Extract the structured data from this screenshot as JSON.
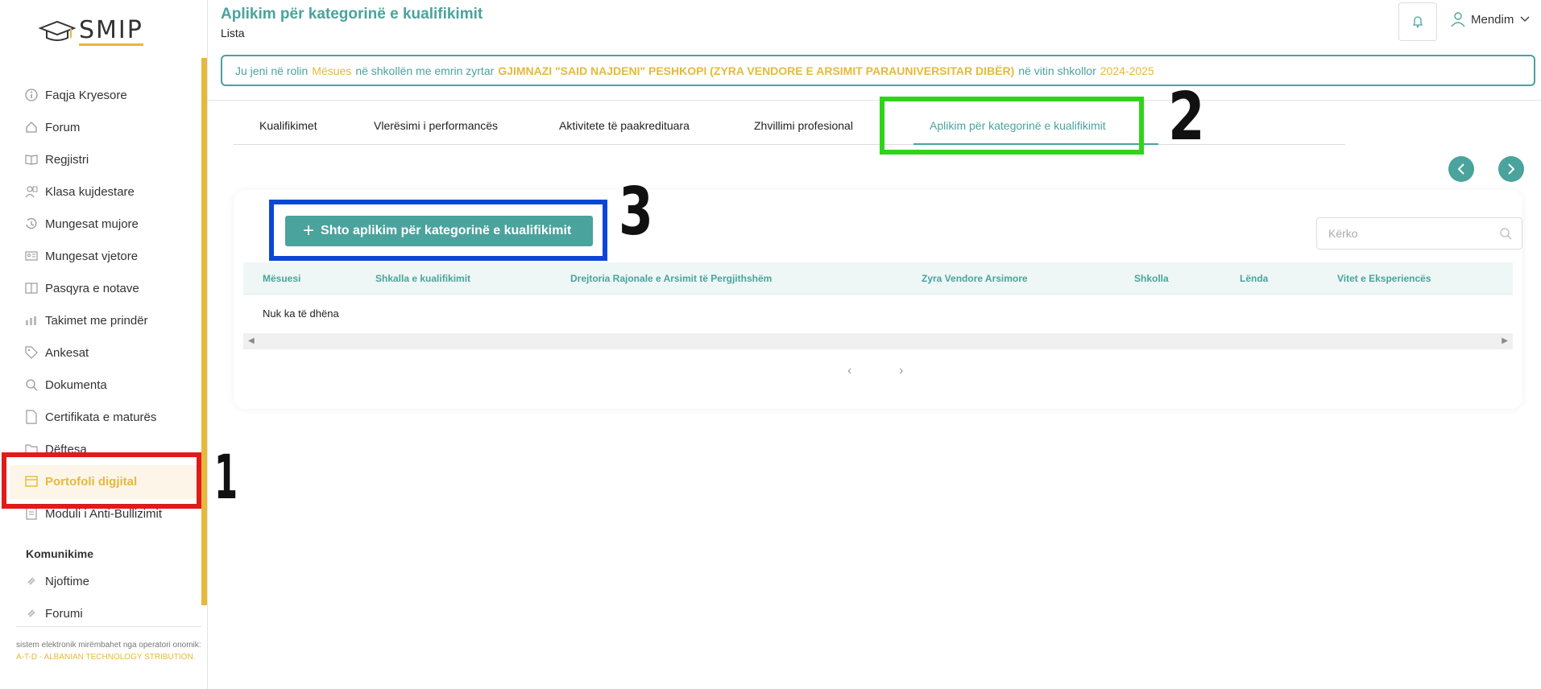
{
  "sidebar": {
    "logo": "SMIP",
    "items": [
      {
        "label": "Faqja Kryesore",
        "icon": "info-icon"
      },
      {
        "label": "Forum",
        "icon": "home-icon"
      },
      {
        "label": "Regjistri",
        "icon": "book-icon"
      },
      {
        "label": "Klasa kujdestare",
        "icon": "class-icon"
      },
      {
        "label": "Mungesat mujore",
        "icon": "history-icon"
      },
      {
        "label": "Mungesat vjetore",
        "icon": "id-card-icon"
      },
      {
        "label": "Pasqyra e notave",
        "icon": "book-open-icon"
      },
      {
        "label": "Takimet me prindër",
        "icon": "chart-icon"
      },
      {
        "label": "Ankesat",
        "icon": "tag-icon"
      },
      {
        "label": "Dokumenta",
        "icon": "search-icon"
      },
      {
        "label": "Certifikata e maturës",
        "icon": "file-icon"
      },
      {
        "label": "Dëftesa",
        "icon": "folder-icon"
      },
      {
        "label": "Portofoli digjital",
        "icon": "calendar-icon",
        "active": true
      },
      {
        "label": "Moduli i Anti-Bullizimit",
        "icon": "document-icon"
      }
    ],
    "section_title": "Komunikime",
    "comm_items": [
      {
        "label": "Njoftime",
        "icon": "link-icon"
      },
      {
        "label": "Forumi",
        "icon": "link-icon"
      }
    ],
    "footer_prefix": "sistem elektronik mirëmbahet nga operatori onomik:",
    "footer_highlight": "A-T-D - ALBANIAN TECHNOLOGY STRIBUTION."
  },
  "header": {
    "title": "Aplikim për kategorinë e kualifikimit",
    "subtitle": "Lista",
    "user_name": "Mendim"
  },
  "role_bar": {
    "p1": "Ju jeni në rolin",
    "role": "Mësues",
    "p2": "në shkollën me emrin zyrtar",
    "school": "GJIMNAZI \"SAID NAJDENI\" PESHKOPI (ZYRA VENDORE E ARSIMIT PARAUNIVERSITAR DIBËR)",
    "p3": "në vitin shkollor",
    "year": "2024-2025"
  },
  "tabs": [
    "Kualifikimet",
    "Vlerësimi i performancës",
    "Aktivitete të paakredituara",
    "Zhvillimi profesional",
    "Aplikim për kategorinë e kualifikimit"
  ],
  "annotations": [
    "1",
    "2",
    "3"
  ],
  "card": {
    "add_button": "Shto aplikim për kategorinë e kualifikimit",
    "search_placeholder": "Kërko",
    "columns": [
      "Mësuesi",
      "Shkalla e kualifikimit",
      "Drejtoria Rajonale e Arsimit të Pergjithshëm",
      "Zyra Vendore Arsimore",
      "Shkolla",
      "Lënda",
      "Vitet e Eksperiencës"
    ],
    "empty_text": "Nuk ka të dhëna"
  },
  "colors": {
    "accent_teal": "#4aa39c",
    "accent_gold": "#e6b93a",
    "annotation_red": "#e01b1b",
    "annotation_green": "#2fd418",
    "annotation_blue": "#0a47d6"
  }
}
